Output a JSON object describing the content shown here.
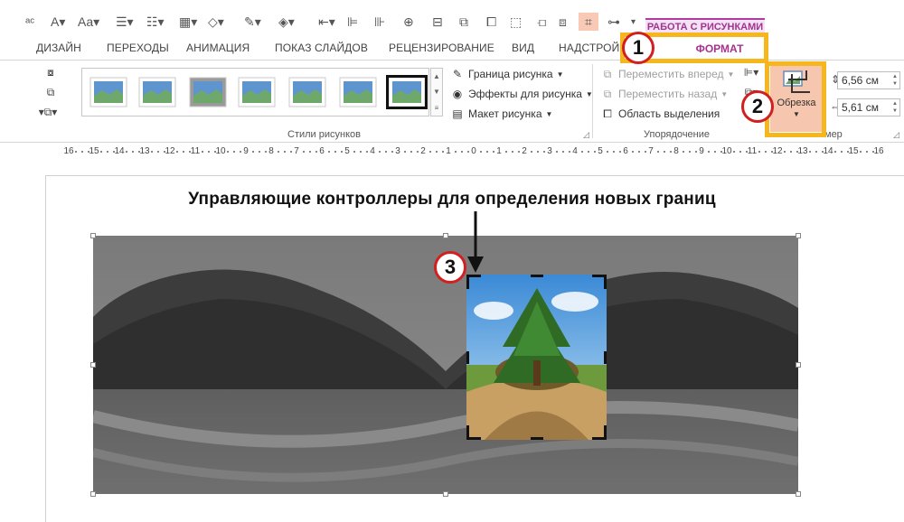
{
  "tabs": {
    "contextual_group": "РАБОТА С РИСУНКАМИ",
    "items": [
      "ДИЗАЙН",
      "ПЕРЕХОДЫ",
      "АНИМАЦИЯ",
      "ПОКАЗ СЛАЙДОВ",
      "РЕЦЕНЗИРОВАНИЕ",
      "ВИД",
      "НАДСТРОЙ"
    ],
    "active": "ФОРМАТ"
  },
  "ribbon": {
    "styles_group": {
      "label": "Стили рисунков",
      "border_label": "Граница рисунка",
      "effects_label": "Эффекты для рисунка",
      "layout_label": "Макет рисунка"
    },
    "arrange_group": {
      "label": "Упорядочение",
      "bring_forward": "Переместить вперед",
      "send_backward": "Переместить назад",
      "selection_pane": "Область выделения"
    },
    "size_group": {
      "crop_label": "Обрезка",
      "height_value": "6,56 см",
      "width_value": "5,61 см",
      "label_partial": "мер"
    }
  },
  "ruler": {
    "labels": [
      "16",
      "15",
      "14",
      "13",
      "12",
      "11",
      "10",
      "9",
      "8",
      "7",
      "6",
      "5",
      "4",
      "3",
      "2",
      "1",
      "0",
      "1",
      "2",
      "3",
      "4",
      "5",
      "6",
      "7",
      "8",
      "9",
      "10",
      "11",
      "12",
      "13",
      "14",
      "15",
      "16"
    ]
  },
  "slide": {
    "heading": "Управляющие контроллеры для определения новых границ"
  },
  "annotations": [
    "1",
    "2",
    "3"
  ],
  "colors": {
    "accent_purple": "#a3338f",
    "highlight_orange": "#f6b71e",
    "badge_red": "#d21f1f",
    "crop_active": "#f7c6ae"
  }
}
